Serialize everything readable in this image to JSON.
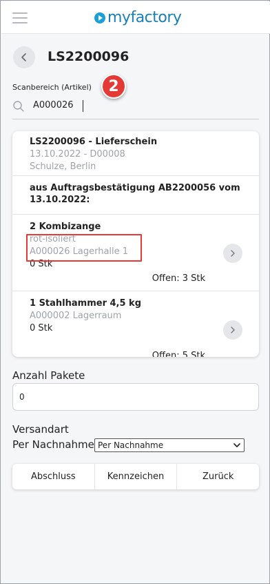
{
  "header": {
    "logo_text": "myfactory",
    "brand_color": "#1aa0d8"
  },
  "page": {
    "title": "LS2200096"
  },
  "scan": {
    "label": "Scanbereich (Artikel)",
    "value": "A000026",
    "step_badge": "2"
  },
  "delivery": {
    "header_title": "LS2200096 - Lieferschein",
    "header_date": "13.10.2022 - D00008",
    "header_customer": "Schulze, Berlin",
    "source_line1": "aus Auftragsbestätigung AB2200056 vom",
    "source_line2": "13.10.2022:",
    "items": [
      {
        "title": "2 Kombizange",
        "detail1": "rot-isoliert",
        "detail2": "A000026 Lagerhalle 1",
        "qty": "0 Stk",
        "open": "Offen: 3 Stk"
      },
      {
        "title": "1 Stahlhammer 4,5 kg",
        "detail1": "A000002 Lagerraum",
        "qty": "0 Stk",
        "open": "Offen: 5 Stk"
      }
    ]
  },
  "form": {
    "pakete_label": "Anzahl Pakete",
    "pakete_value": "0",
    "versand_label": "Versandart",
    "nachnahme_label": "Per Nachnahme",
    "nachnahme_selected": "Per Nachnahme"
  },
  "buttons": {
    "abschluss": "Abschluss",
    "kennzeichen": "Kennzeichen",
    "zurueck": "Zurück"
  },
  "colors": {
    "highlight_red": "#e53935"
  }
}
